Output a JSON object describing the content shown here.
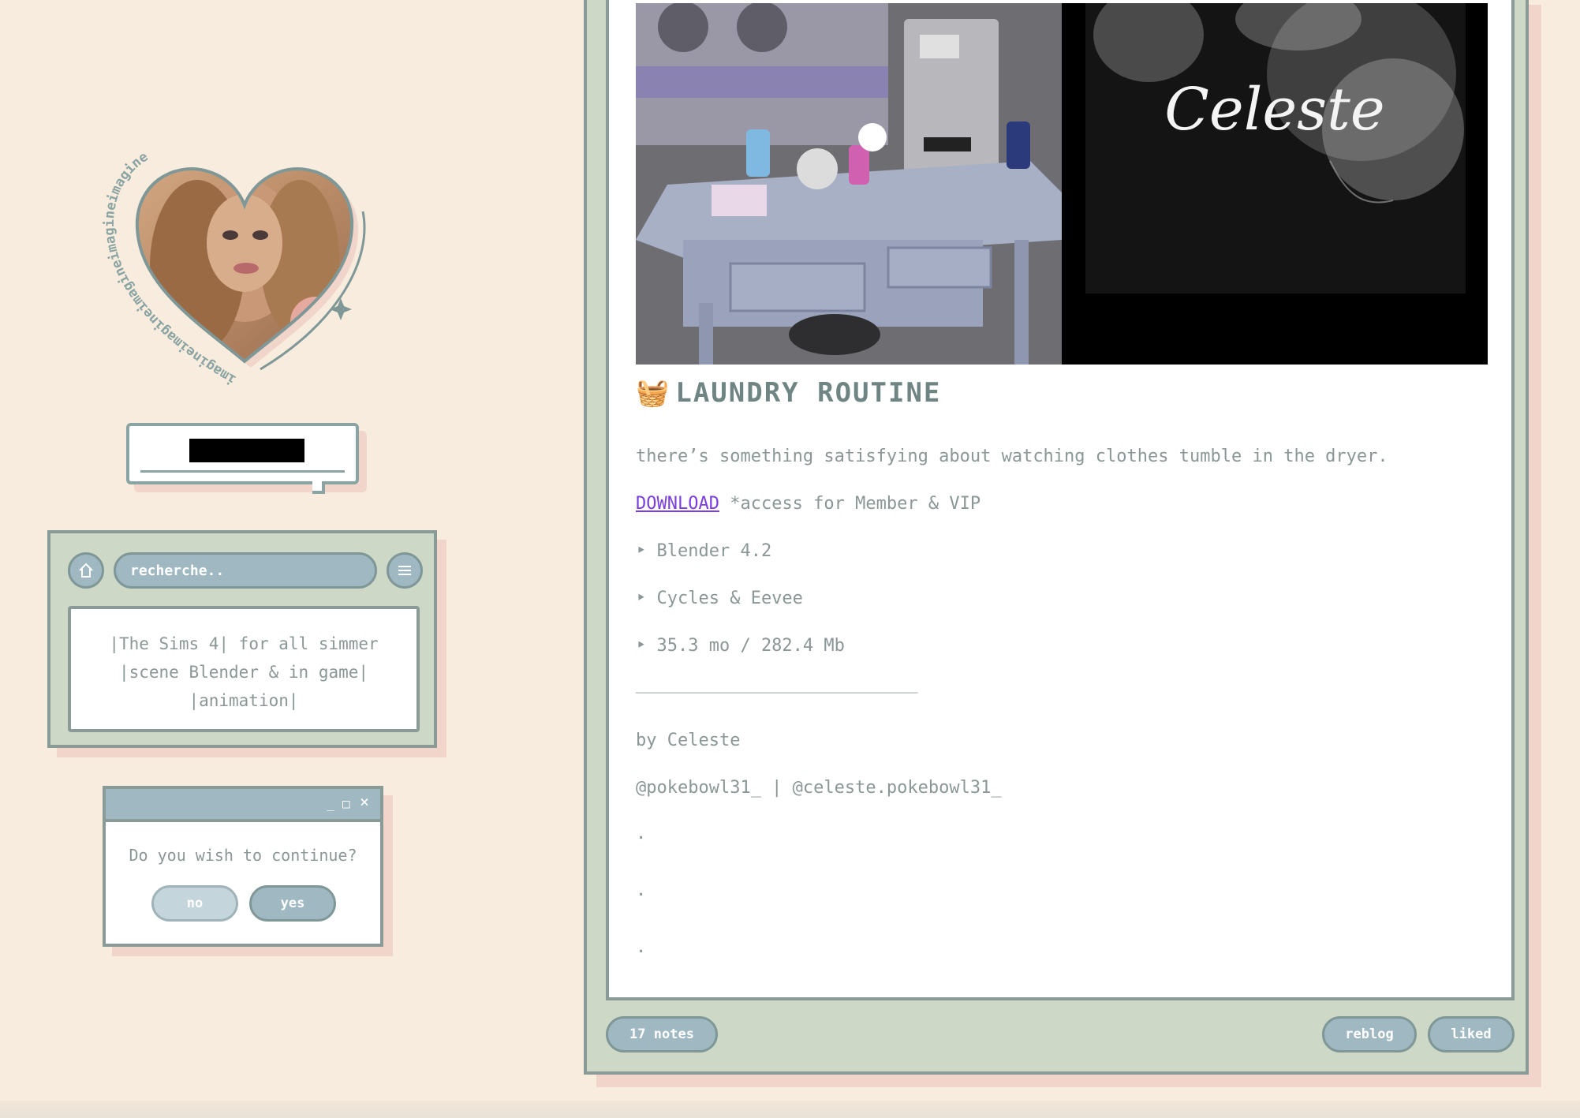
{
  "sidebar": {
    "avatar_ring_text": "imagineimagineimagineimagineimagine",
    "search": {
      "placeholder": "recherche.."
    },
    "description": [
      "|The Sims 4| for all simmer",
      "|scene Blender & in game|",
      "|animation|"
    ],
    "dialog": {
      "minimize": "_",
      "maximize": "□",
      "close": "×",
      "question": "Do you wish to continue?",
      "no_label": "no",
      "yes_label": "yes"
    }
  },
  "post": {
    "image_caption": "Celeste",
    "title_emoji": "🧺",
    "title": "LAUNDRY ROUTINE",
    "subtitle": "there’s something satisfying about watching clothes tumble in the dryer.",
    "download_link": "DOWNLOAD",
    "download_note": " *access for Member & VIP",
    "specs": [
      "‣ Blender 4.2",
      "‣ Cycles & Eevee",
      "‣  35.3 mo / 282.4 Mb"
    ],
    "separator": "___________________________",
    "author": "by Celeste",
    "handles": "@pokebowl31_ | @celeste.pokebowl31_",
    "dots": [
      ".",
      ".",
      "."
    ]
  },
  "footer": {
    "notes_label": "17 notes",
    "reblog_label": "reblog",
    "liked_label": "liked"
  },
  "colors": {
    "background": "#f7ecdd",
    "window": "#ced8c6",
    "accent": "#9fb8c2",
    "border": "#8a9a96",
    "shadow": "#f1d5cb",
    "link": "#7a3ee0"
  }
}
